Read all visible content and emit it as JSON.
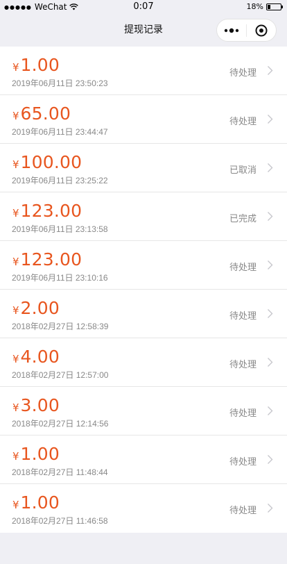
{
  "status_bar": {
    "signal": "●●●●●",
    "carrier": "WeChat",
    "time": "0:07",
    "battery": "18%"
  },
  "nav": {
    "title": "提现记录"
  },
  "colors": {
    "amount": "#e8561f",
    "secondary_text": "#888888",
    "background": "#efeff4"
  },
  "records": [
    {
      "currency": "¥",
      "amount": "1.00",
      "time": "2019年06月11日 23:50:23",
      "status": "待处理"
    },
    {
      "currency": "¥",
      "amount": "65.00",
      "time": "2019年06月11日 23:44:47",
      "status": "待处理"
    },
    {
      "currency": "¥",
      "amount": "100.00",
      "time": "2019年06月11日 23:25:22",
      "status": "已取消"
    },
    {
      "currency": "¥",
      "amount": "123.00",
      "time": "2019年06月11日 23:13:58",
      "status": "已完成"
    },
    {
      "currency": "¥",
      "amount": "123.00",
      "time": "2019年06月11日 23:10:16",
      "status": "待处理"
    },
    {
      "currency": "¥",
      "amount": "2.00",
      "time": "2018年02月27日 12:58:39",
      "status": "待处理"
    },
    {
      "currency": "¥",
      "amount": "4.00",
      "time": "2018年02月27日 12:57:00",
      "status": "待处理"
    },
    {
      "currency": "¥",
      "amount": "3.00",
      "time": "2018年02月27日 12:14:56",
      "status": "待处理"
    },
    {
      "currency": "¥",
      "amount": "1.00",
      "time": "2018年02月27日 11:48:44",
      "status": "待处理"
    },
    {
      "currency": "¥",
      "amount": "1.00",
      "time": "2018年02月27日 11:46:58",
      "status": "待处理"
    }
  ]
}
